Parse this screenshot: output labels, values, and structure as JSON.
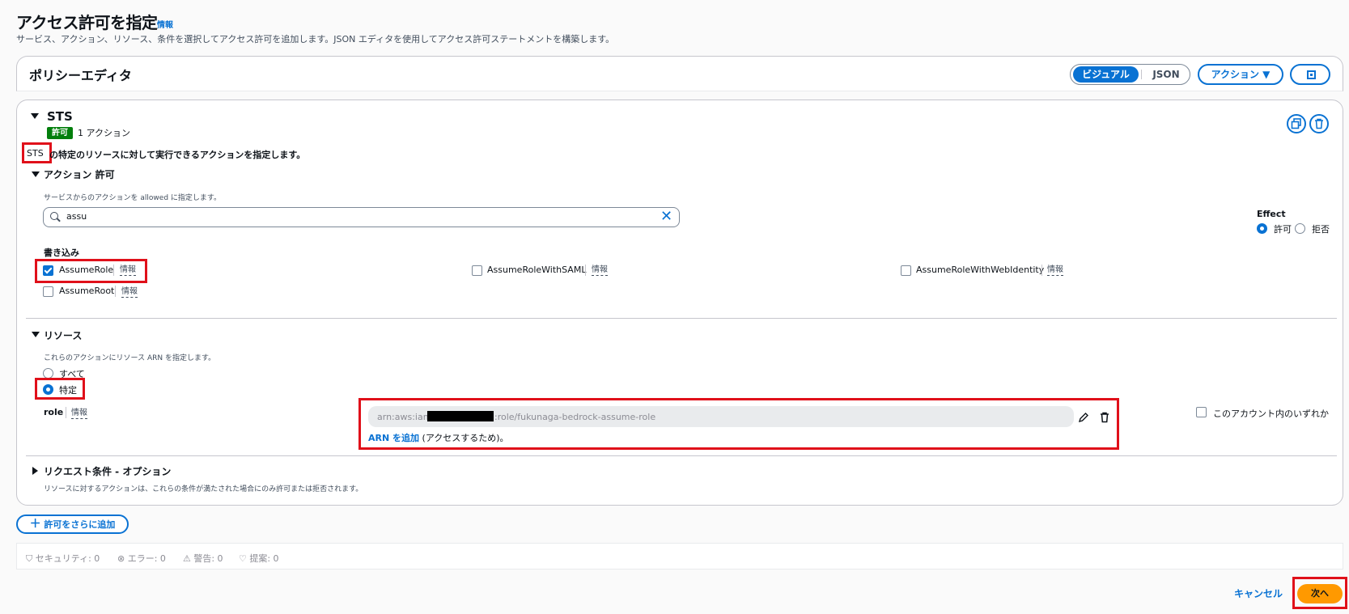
{
  "page": {
    "title": "アクセス許可を指定",
    "info": "情報",
    "subtitle": "サービス、アクション、リソース、条件を選択してアクセス許可を追加します。JSON エディタを使用してアクセス許可ステートメントを構築します。"
  },
  "editor": {
    "title": "ポリシーエディタ",
    "mode_visual": "ビジュアル",
    "mode_json": "JSON",
    "actions_button": "アクション ▼"
  },
  "statement": {
    "service": "STS",
    "badge": "許可",
    "action_count": "1 アクション",
    "desc_service": "STS",
    "desc_text": "の特定のリソースに対して実行できるアクションを指定します。"
  },
  "actions_section": {
    "title": "アクション 許可",
    "help": "サービスからのアクションを allowed に指定します。",
    "search_value": "assu",
    "effect_label": "Effect",
    "effect_allow": "許可",
    "effect_deny": "拒否",
    "group_title": "書き込み",
    "items": [
      {
        "label": "AssumeRole",
        "checked": true,
        "info": "情報"
      },
      {
        "label": "AssumeRoleWithSAML",
        "checked": false,
        "info": "情報"
      },
      {
        "label": "AssumeRoleWithWebIdentity",
        "checked": false,
        "info": "情報"
      },
      {
        "label": "AssumeRoot",
        "checked": false,
        "info": "情報"
      }
    ]
  },
  "resources": {
    "title": "リソース",
    "help": "これらのアクションにリソース ARN を指定します。",
    "option_all": "すべて",
    "option_specific": "特定",
    "role_label": "role",
    "role_info": "情報",
    "arn_prefix": "arn:aws:iam:",
    "arn_suffix": ":role/fukunaga-bedrock-assume-role",
    "arn_add_link": "ARN を追加",
    "arn_add_suffix": " (アクセスするため)。",
    "any_in_account": "このアカウント内のいずれか"
  },
  "conditions": {
    "title": "リクエスト条件 - オプション",
    "help": "リソースに対するアクションは、これらの条件が満たされた場合にのみ許可または拒否されます。"
  },
  "add_more_button": "許可をさらに追加",
  "status": {
    "security": "セキュリティ: 0",
    "errors": "エラー: 0",
    "warnings": "警告: 0",
    "suggestions": "提案: 0"
  },
  "footer": {
    "cancel": "キャンセル",
    "next": "次へ"
  },
  "colors": {
    "primary": "#0972d3",
    "allow_badge": "#037f0c",
    "next_button": "#ff9900",
    "highlight": "#e0101a"
  }
}
